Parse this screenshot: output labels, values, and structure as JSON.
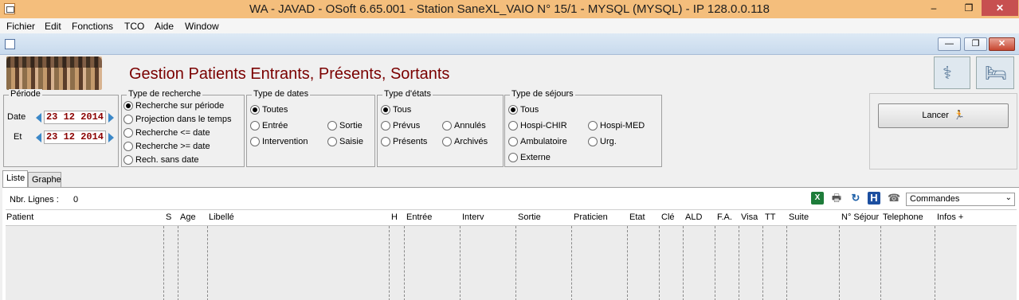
{
  "window": {
    "title": "WA - JAVAD - OSoft 6.65.001 - Station SaneXL_VAIO N° 15/1 - MYSQL (MYSQL) - IP 128.0.0.118",
    "min_glyph": "–",
    "max_glyph": "❐",
    "close_glyph": "✕"
  },
  "menu": [
    "Fichier",
    "Edit",
    "Fonctions",
    "TCO",
    "Aide",
    "Window"
  ],
  "child_controls": {
    "min": "—",
    "restore": "❐",
    "close": "✕"
  },
  "header": {
    "title": "Gestion Patients Entrants, Présents, Sortants"
  },
  "periode": {
    "label": "Période",
    "date_label": "Date",
    "date_value": "23 12 2014",
    "et_label": "Et",
    "et_value": "23 12 2014"
  },
  "type_recherche": {
    "label": "Type de recherche",
    "options": [
      {
        "label": "Recherche sur période",
        "selected": true
      },
      {
        "label": "Projection dans le temps",
        "selected": false
      },
      {
        "label": "Recherche <= date",
        "selected": false
      },
      {
        "label": "Recherche >= date",
        "selected": false
      },
      {
        "label": "Rech. sans date",
        "selected": false
      }
    ]
  },
  "type_dates": {
    "label": "Type de dates",
    "options": [
      {
        "label": "Toutes",
        "selected": true
      },
      {
        "label": "Entrée",
        "selected": false
      },
      {
        "label": "Sortie",
        "selected": false
      },
      {
        "label": "Intervention",
        "selected": false
      },
      {
        "label": "Saisie",
        "selected": false
      }
    ]
  },
  "type_etats": {
    "label": "Type d'états",
    "options": [
      {
        "label": "Tous",
        "selected": true
      },
      {
        "label": "Prévus",
        "selected": false
      },
      {
        "label": "Annulés",
        "selected": false
      },
      {
        "label": "Présents",
        "selected": false
      },
      {
        "label": "Archivés",
        "selected": false
      }
    ]
  },
  "type_sejours": {
    "label": "Type de séjours",
    "options": [
      {
        "label": "Tous",
        "selected": true
      },
      {
        "label": "Hospi-CHIR",
        "selected": false
      },
      {
        "label": "Hospi-MED",
        "selected": false
      },
      {
        "label": "Ambulatoire",
        "selected": false
      },
      {
        "label": "Urg.",
        "selected": false
      },
      {
        "label": "Externe",
        "selected": false
      }
    ]
  },
  "launch": {
    "label": "Lancer",
    "icon": "running-man-icon"
  },
  "tabs": [
    "Liste",
    "Graphe"
  ],
  "list": {
    "count_label": "Nbr. Lignes :",
    "count_value": "0",
    "commandes": "Commandes",
    "icons": {
      "excel": "X",
      "print": "🖶",
      "refresh": "↻",
      "h": "H",
      "phone": "☎"
    },
    "columns": [
      "Patient",
      "S",
      "Age",
      "Libellé",
      "H",
      "Entrée",
      "Interv",
      "Sortie",
      "Praticien",
      "Etat",
      "Clé",
      "ALD",
      "F.A.",
      "Visa",
      "TT",
      "Suite",
      "N° Séjour",
      "Telephone",
      "Infos +"
    ]
  }
}
